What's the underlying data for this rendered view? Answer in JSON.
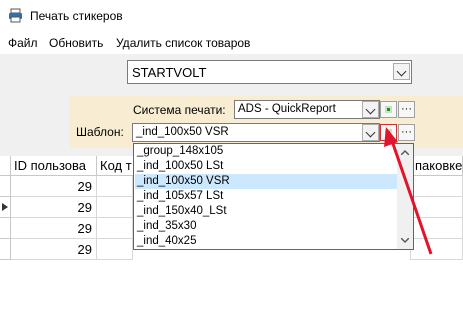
{
  "window": {
    "title": "Печать стикеров"
  },
  "menu": {
    "file": "Файл",
    "refresh": "Обновить",
    "delete_list": "Удалить список товаров"
  },
  "company_combo": {
    "value": "STARTVOLT"
  },
  "print_system": {
    "label": "Система печати:",
    "value": "ADS - QuickReport"
  },
  "template": {
    "label": "Шаблон:",
    "value": "_ind_100x50 VSR"
  },
  "template_options": [
    {
      "label": "_group_148x105",
      "selected": false
    },
    {
      "label": "_ind_100x50 LSt",
      "selected": false
    },
    {
      "label": "_ind_100x50 VSR",
      "selected": true
    },
    {
      "label": "_ind_105x57 LSt",
      "selected": false
    },
    {
      "label": "_ind_150x40_LSt",
      "selected": false
    },
    {
      "label": "_ind_35x30",
      "selected": false
    },
    {
      "label": "_ind_40x25",
      "selected": false
    }
  ],
  "grid": {
    "columns": [
      "ID пользова",
      "Код т",
      "паковке"
    ],
    "rows": [
      {
        "id": "29"
      },
      {
        "id": "29"
      },
      {
        "id": "29"
      },
      {
        "id": "29"
      }
    ]
  },
  "icons": {
    "app": "printer-icon",
    "dropdown": "chevron-down-icon",
    "add": "green-square-icon",
    "more": "ellipsis-icon",
    "row_pointer": "triangle-right-icon",
    "annotation": "red-arrow"
  },
  "colors": {
    "panel_bg": "#f8edd2",
    "selection": "#cce8ff",
    "annotation": "#e0142a"
  }
}
